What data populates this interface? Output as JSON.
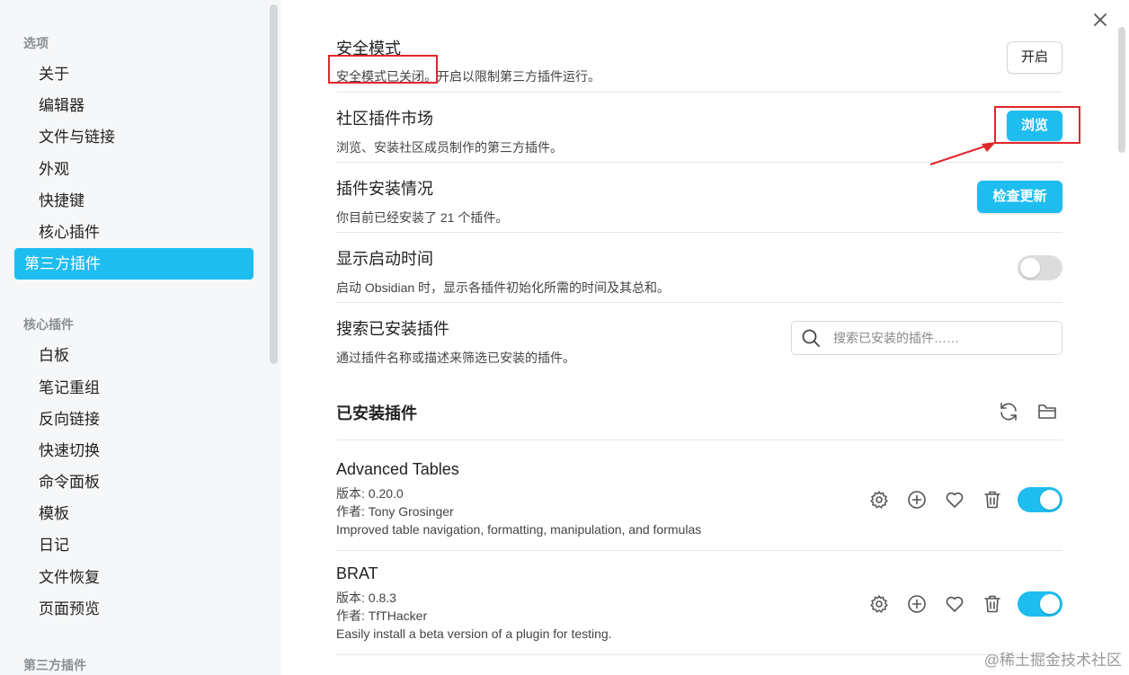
{
  "sidebar": {
    "section_options": "选项",
    "options": [
      "关于",
      "编辑器",
      "文件与链接",
      "外观",
      "快捷键",
      "核心插件",
      "第三方插件"
    ],
    "section_core": "核心插件",
    "core": [
      "白板",
      "笔记重组",
      "反向链接",
      "快速切换",
      "命令面板",
      "模板",
      "日记",
      "文件恢复",
      "页面预览"
    ],
    "section_third": "第三方插件"
  },
  "settings": {
    "safe_mode": {
      "title": "安全模式",
      "desc_highlight": "安全模式已关闭",
      "desc_rest": "。开启以限制第三方插件运行。",
      "button": "开启"
    },
    "community": {
      "title": "社区插件市场",
      "desc": "浏览、安装社区成员制作的第三方插件。",
      "button": "浏览"
    },
    "install": {
      "title": "插件安装情况",
      "desc": "你目前已经安装了 21 个插件。",
      "button": "检查更新"
    },
    "startup": {
      "title": "显示启动时间",
      "desc": "启动 Obsidian 时，显示各插件初始化所需的时间及其总和。",
      "toggle_on": false
    },
    "search": {
      "title": "搜索已安装插件",
      "desc": "通过插件名称或描述来筛选已安装的插件。",
      "placeholder": "搜索已安装的插件……"
    }
  },
  "installed": {
    "heading": "已安装插件",
    "plugins": [
      {
        "name": "Advanced Tables",
        "version": "版本: 0.20.0",
        "author": "作者: Tony Grosinger",
        "desc": "Improved table navigation, formatting, manipulation, and formulas",
        "enabled": true
      },
      {
        "name": "BRAT",
        "version": "版本: 0.8.3",
        "author": "作者: TfTHacker",
        "desc": "Easily install a beta version of a plugin for testing.",
        "enabled": true
      }
    ]
  },
  "watermark": "@稀土掘金技术社区",
  "colors": {
    "accent": "#1ebdf0",
    "annotation": "#e0262b"
  },
  "icons": [
    "close-icon",
    "search-icon",
    "refresh-icon",
    "folder-icon",
    "gear-icon",
    "plus-circle-icon",
    "heart-icon",
    "trash-icon"
  ]
}
